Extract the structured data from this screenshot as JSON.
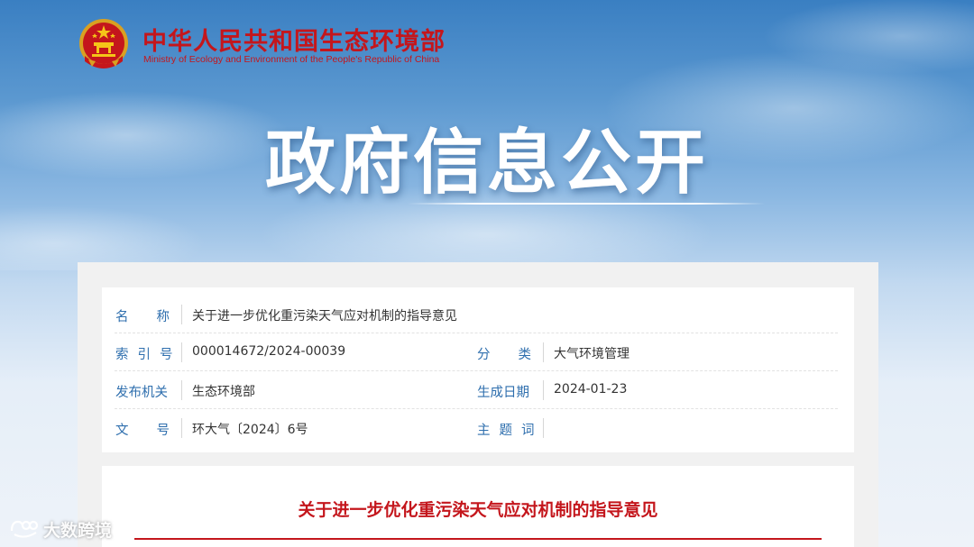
{
  "header": {
    "org_name_cn": "中华人民共和国生态环境部",
    "org_name_en": "Ministry of Ecology and Environment of the People's Republic of China",
    "emblem_icon": "national-emblem-icon"
  },
  "banner": {
    "title": "政府信息公开"
  },
  "metadata": {
    "name_label": "名称",
    "name_value": "关于进一步优化重污染天气应对机制的指导意见",
    "index_label": "索引号",
    "index_value": "000014672/2024-00039",
    "category_label": "分类",
    "category_value": "大气环境管理",
    "issuer_label": "发布机关",
    "issuer_value": "生态环境部",
    "date_label": "生成日期",
    "date_value": "2024-01-23",
    "doc_no_label": "文号",
    "doc_no_value": "环大气〔2024〕6号",
    "keywords_label": "主题词",
    "keywords_value": ""
  },
  "document": {
    "title": "关于进一步优化重污染天气应对机制的指导意见"
  },
  "watermark": {
    "text": "大数跨境",
    "icon": "brand-logo-icon"
  },
  "colors": {
    "brand_red": "#c4161c",
    "label_blue": "#2f6fae"
  }
}
